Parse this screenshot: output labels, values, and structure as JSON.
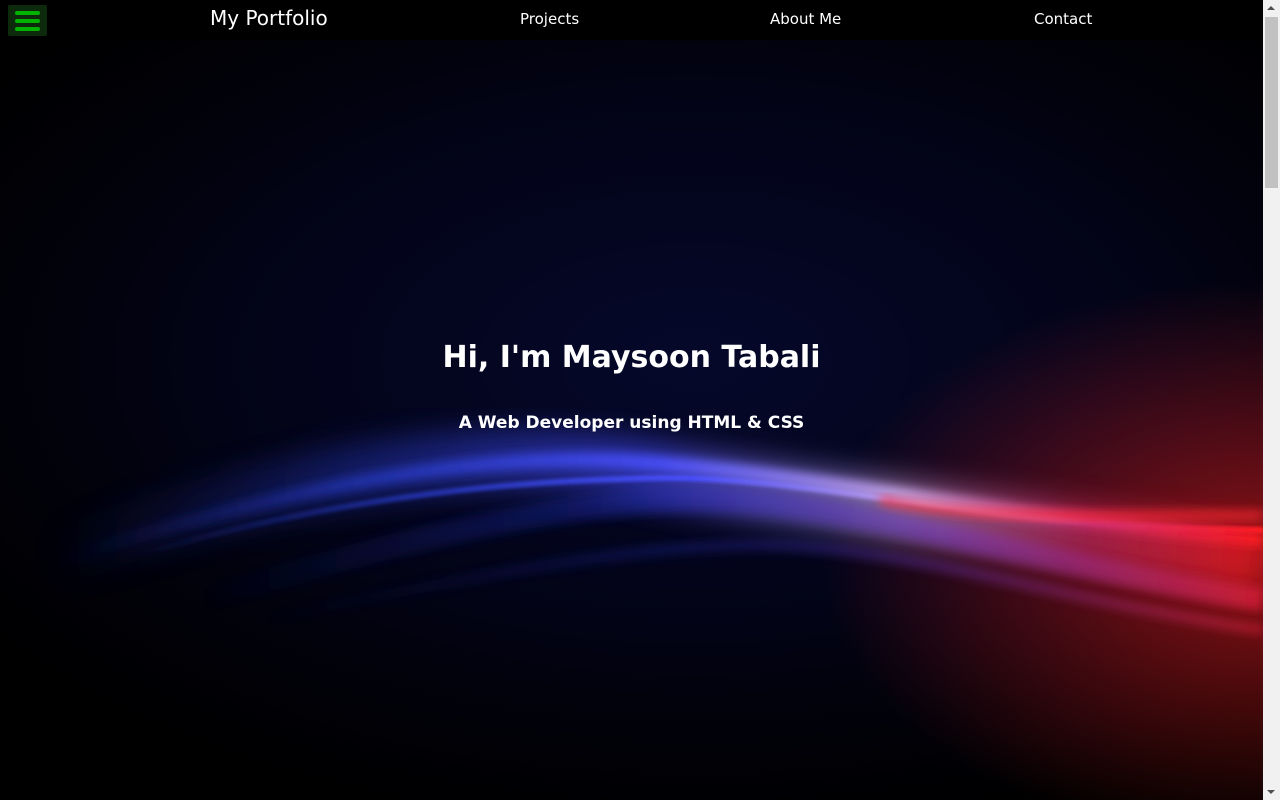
{
  "navbar": {
    "menu_icon": "hamburger-menu-icon",
    "brand": "My Portfolio",
    "links": [
      "Projects",
      "About Me",
      "Contact"
    ]
  },
  "hero": {
    "title": "Hi, I'm Maysoon Tabali",
    "subtitle": "A Web Developer using HTML & CSS"
  },
  "colors": {
    "nav_background": "#000000",
    "menu_icon_color": "#00b300",
    "text": "#ffffff",
    "wave_blue": "#3a3cff",
    "wave_red": "#ff1a2a"
  }
}
